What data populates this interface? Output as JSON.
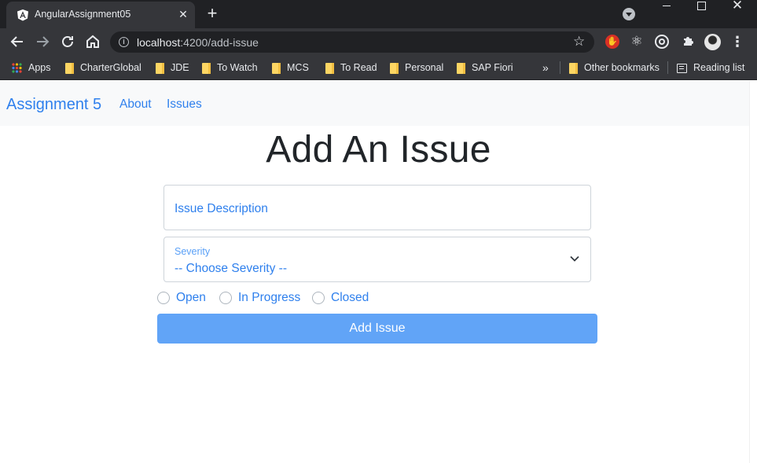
{
  "browser": {
    "tab": {
      "title": "AngularAssignment05",
      "logo_icon": "angular-logo-icon"
    },
    "address": {
      "host": "localhost",
      "path": ":4200/add-issue"
    },
    "bookmarks": [
      {
        "label": "Apps",
        "icon": "apps-grid-icon"
      },
      {
        "label": "CharterGlobal",
        "icon": "folder-icon"
      },
      {
        "label": "JDE",
        "icon": "folder-icon"
      },
      {
        "label": "To Watch",
        "icon": "folder-icon"
      },
      {
        "label": "MCS",
        "icon": "folder-icon"
      },
      {
        "label": "To Read",
        "icon": "folder-icon"
      },
      {
        "label": "Personal",
        "icon": "folder-icon"
      },
      {
        "label": "SAP Fiori",
        "icon": "folder-icon"
      }
    ],
    "overflow_chevron": "»",
    "other_bookmarks": "Other bookmarks",
    "reading_list": "Reading list"
  },
  "app": {
    "brand": "Assignment 5",
    "nav": [
      "About",
      "Issues"
    ]
  },
  "form": {
    "heading": "Add An Issue",
    "description_placeholder": "Issue Description",
    "severity_label": "Severity",
    "severity_value": "-- Choose Severity --",
    "status_options": [
      "Open",
      "In Progress",
      "Closed"
    ],
    "submit_label": "Add Issue"
  },
  "colors": {
    "link": "#2f80ed",
    "button": "#61a4f7",
    "browser_dark": "#202124",
    "browser_toolbar": "#35363a"
  }
}
